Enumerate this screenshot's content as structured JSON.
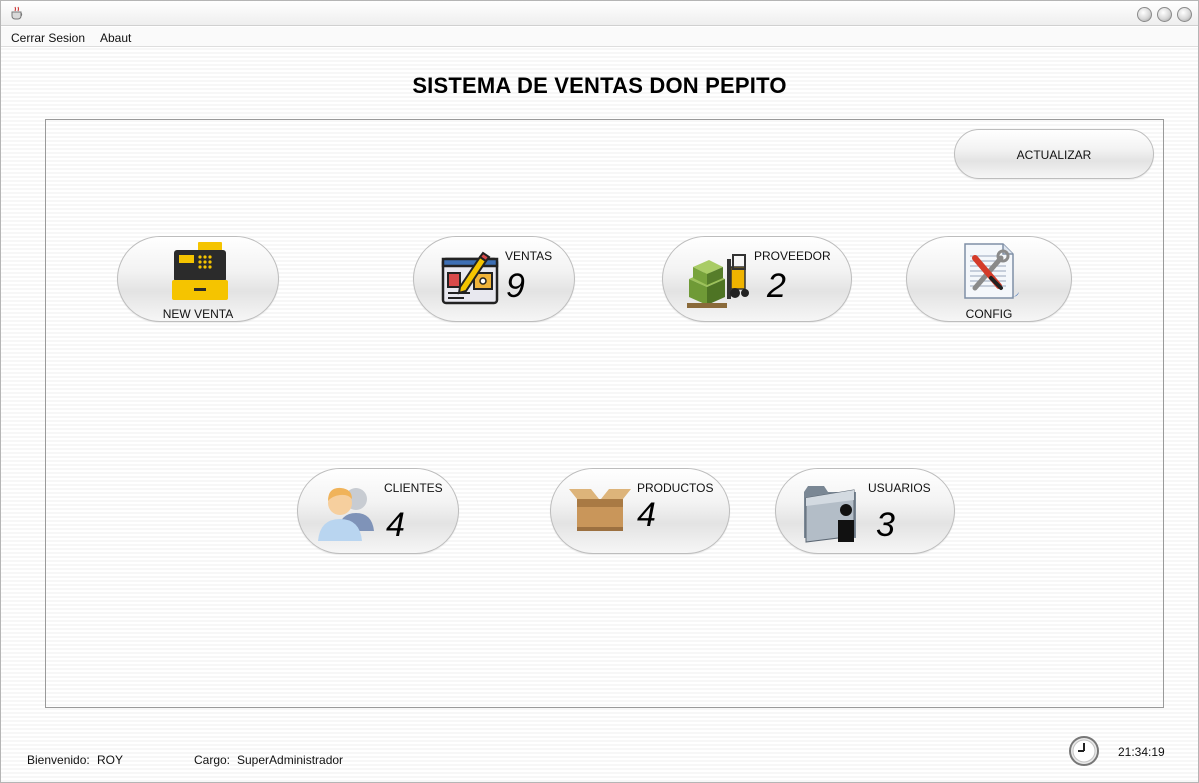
{
  "window": {
    "title": ""
  },
  "menu": {
    "items": [
      "Cerrar Sesion",
      "Abaut"
    ]
  },
  "header": {
    "title": "SISTEMA DE VENTAS DON PEPITO"
  },
  "actions": {
    "refresh_label": "ACTUALIZAR"
  },
  "tiles": {
    "new_venta": {
      "label": "NEW VENTA",
      "icon": "cash-register-icon"
    },
    "ventas": {
      "label": "VENTAS",
      "count": "9",
      "icon": "sales-form-icon"
    },
    "proveedor": {
      "label": "PROVEEDOR",
      "count": "2",
      "icon": "forklift-icon"
    },
    "config": {
      "label": "CONFIG",
      "icon": "tools-icon"
    },
    "clientes": {
      "label": "CLIENTES",
      "count": "4",
      "icon": "users-icon"
    },
    "productos": {
      "label": "PRODUCTOS",
      "count": "4",
      "icon": "box-icon"
    },
    "usuarios": {
      "label": "USUARIOS",
      "count": "3",
      "icon": "user-folder-icon"
    }
  },
  "status": {
    "welcome_label": "Bienvenido:",
    "user": "ROY",
    "role_label": "Cargo:",
    "role": "SuperAdministrador",
    "time": "21:34:19"
  },
  "colors": {
    "accent_yellow": "#f5c400",
    "panel_border": "#9a9a9a"
  }
}
